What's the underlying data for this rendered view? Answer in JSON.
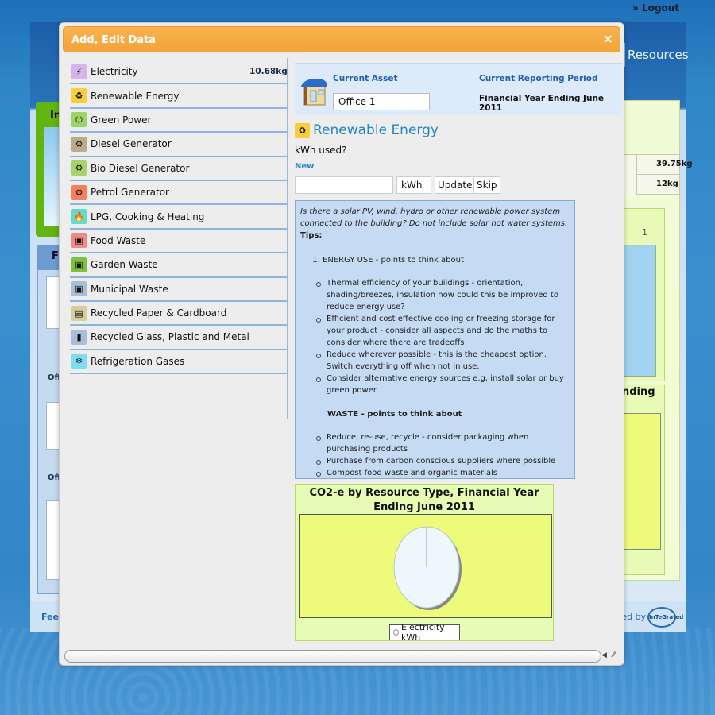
{
  "header": {
    "logout_label": "» Logout",
    "nav_resources": "Resources"
  },
  "background": {
    "green_panel_title": "In",
    "blue_panel_title": "F",
    "section_labels": [
      "Off",
      "Off"
    ],
    "right_values": [
      "39.75kg",
      "12kg"
    ],
    "bar_chart_tick": "1",
    "chart_title_fragment": "nding",
    "footer_feedback": "Feed",
    "footer_powered": "ted by",
    "footer_logo": "InTeGrated"
  },
  "modal": {
    "title": "Add, Edit Data",
    "close_label": "×",
    "resources": [
      {
        "label": "Electricity",
        "value": "10.68kg",
        "icon": "lightning-icon",
        "color": "#d9b3ea",
        "glyph": "⚡"
      },
      {
        "label": "Renewable Energy",
        "value": "",
        "icon": "recycle-icon",
        "color": "#f7cf3b",
        "glyph": "♻"
      },
      {
        "label": "Green Power",
        "value": "",
        "icon": "plug-icon",
        "color": "#9ed36a",
        "glyph": "⏻"
      },
      {
        "label": "Diesel Generator",
        "value": "",
        "icon": "gear-icon",
        "color": "#b9ac88",
        "glyph": "⚙"
      },
      {
        "label": "Bio Diesel Generator",
        "value": "",
        "icon": "gear-icon",
        "color": "#a6d46b",
        "glyph": "⚙"
      },
      {
        "label": "Petrol Generator",
        "value": "",
        "icon": "gear-icon",
        "color": "#f3805e",
        "glyph": "⚙"
      },
      {
        "label": "LPG, Cooking & Heating",
        "value": "",
        "icon": "flame-icon",
        "color": "#5fdccc",
        "glyph": "🔥"
      },
      {
        "label": "Food Waste",
        "value": "",
        "icon": "food-bin-icon",
        "color": "#f08a8a",
        "glyph": "▣"
      },
      {
        "label": "Garden Waste",
        "value": "",
        "icon": "garden-bin-icon",
        "color": "#7cc23e",
        "glyph": "▣"
      },
      {
        "label": "Municipal Waste",
        "value": "",
        "icon": "trash-bin-icon",
        "color": "#a9bfd8",
        "glyph": "▣"
      },
      {
        "label": "Recycled Paper & Cardboard",
        "value": "",
        "icon": "paper-recycle-icon",
        "color": "#d8cca0",
        "glyph": "▤"
      },
      {
        "label": "Recycled Glass, Plastic and Metal",
        "value": "",
        "icon": "bottle-icon",
        "color": "#a9bfd8",
        "glyph": "▮"
      },
      {
        "label": "Refrigeration Gases",
        "value": "",
        "icon": "snowflake-icon",
        "color": "#7fdcf5",
        "glyph": "❄"
      }
    ],
    "asset": {
      "current_asset_label": "Current Asset",
      "current_asset_value": "Office 1",
      "reporting_period_label": "Current Reporting Period",
      "reporting_period_value": "Financial Year Ending June 2011"
    },
    "form": {
      "section_title": "Renewable Energy",
      "question": "kWh used?",
      "new_label": "New",
      "amount_value": "",
      "unit": "kWh",
      "update_label": "Update",
      "skip_label": "Skip"
    },
    "tips": {
      "question": "Is there a solar PV, wind, hydro or other renewable power system connected to the building? Do not include solar hot water systems.",
      "tips_label": "Tips:",
      "energy_heading": "ENERGY USE - points to think about",
      "energy_points": [
        "Thermal efficiency of your buildings - orientation, shading/breezes, insulation how could this be improved to reduce energy use?",
        "Efficient and cost effective cooling or freezing storage for your product - consider all aspects and do the maths to consider where there are tradeoffs",
        "Reduce wherever possible - this is the cheapest option. Switch everything off when not in use.",
        "Consider alternative energy sources e.g. install solar or buy green power"
      ],
      "waste_heading": "WASTE - points to think about",
      "waste_points": [
        "Reduce, re-use, recycle - consider packaging when purchasing products",
        "Purchase from carbon conscious suppliers where possible",
        "Compost food waste and organic materials"
      ]
    }
  },
  "chart_data": {
    "type": "pie",
    "title": "CO2-e by Resource Type, Financial Year Ending June 2011",
    "categories": [
      "Electricity kWh"
    ],
    "values": [
      100
    ],
    "colors": [
      "#eef8fc"
    ],
    "legend": [
      "Electricity kWh"
    ],
    "legend_position": "bottom"
  }
}
